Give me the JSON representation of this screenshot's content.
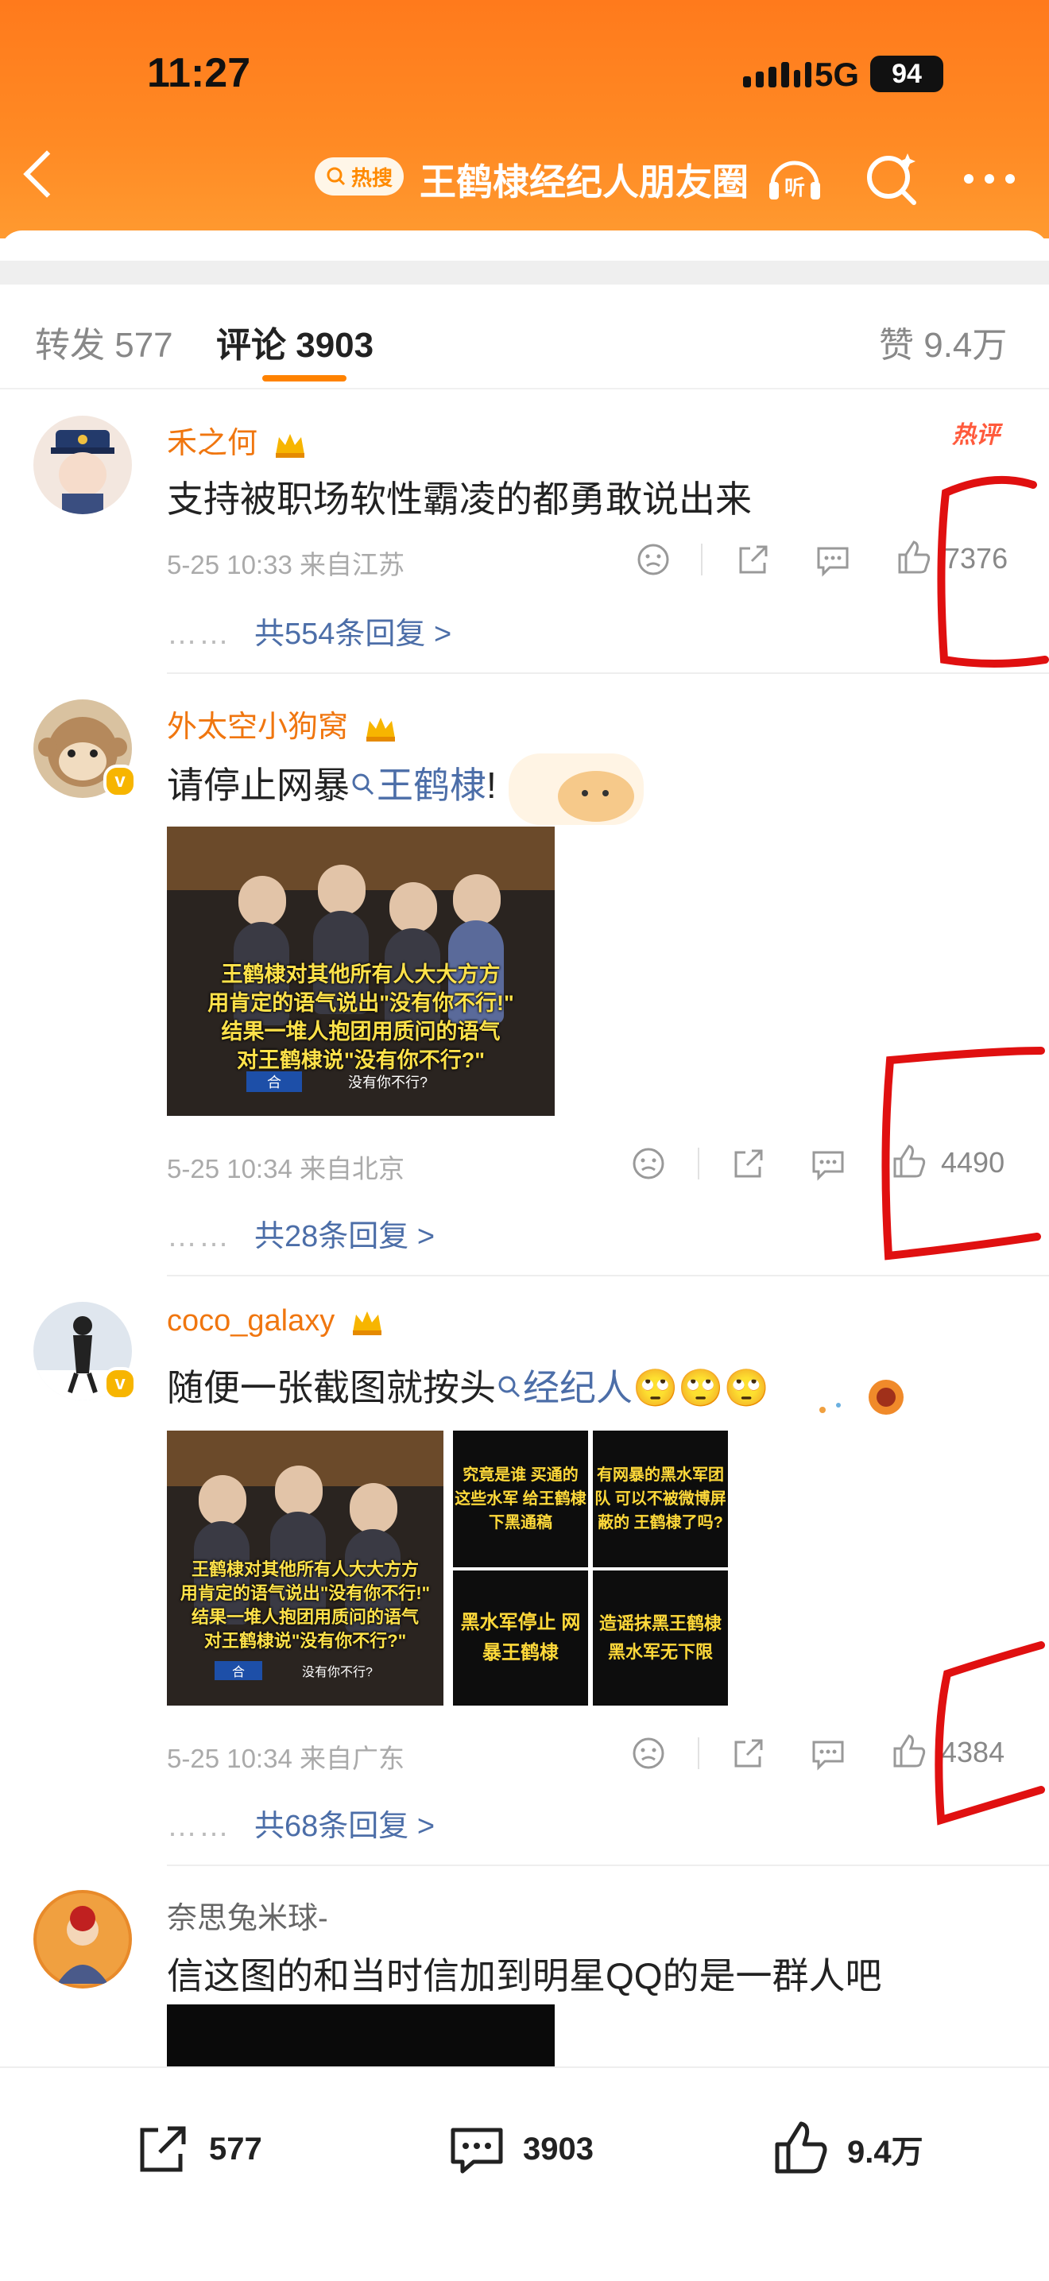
{
  "status": {
    "time": "11:27",
    "network": "5G",
    "battery": "94"
  },
  "header": {
    "hot_badge": "热搜",
    "title": "王鹤棣经纪人朋友圈"
  },
  "tabs": {
    "repost": "转发 577",
    "comments": "评论 3903",
    "likes": "赞 9.4万"
  },
  "hot_tag": "热评",
  "comments": [
    {
      "user": "禾之何",
      "text": "支持被职场软性霸凌的都勇敢说出来",
      "meta": "5-25 10:33 来自江苏",
      "likes": "7376",
      "replies": "共554条回复 >"
    },
    {
      "user": "外太空小狗窝",
      "text_before": "请停止网暴",
      "link": "王鹤棣",
      "text_after": "!",
      "meta": "5-25 10:34 来自北京",
      "likes": "4490",
      "replies": "共28条回复 >",
      "image_caption": [
        "王鹤棣对其他所有人大大方方",
        "用肯定的语气说出\"没有你不行!\"",
        "结果一堆人抱团用质问的语气",
        "对王鹤棣说\"没有你不行?\""
      ],
      "image_sub": "没有你不行?",
      "image_corner": "合"
    },
    {
      "user": "coco_galaxy",
      "text_before": "随便一张截图就按头",
      "link": "经纪人",
      "emoji": "🙄🙄🙄",
      "meta": "5-25 10:34 来自广东",
      "likes": "4384",
      "replies": "共68条回复 >",
      "image_caption": [
        "王鹤棣对其他所有人大大方方",
        "用肯定的语气说出\"没有你不行!\"",
        "结果一堆人抱团用质问的语气",
        "对王鹤棣说\"没有你不行?\""
      ],
      "image_sub": "没有你不行?",
      "image_corner": "合",
      "tiles": [
        "究竟是谁 买通的 这些水军 给王鹤棣 下黑通稿",
        "有网暴的黑水军团队 可以不被微博屏蔽的 王鹤棣了吗?",
        "黑水军停止 网暴王鹤棣",
        "造谣抹黑王鹤棣 黑水军无下限"
      ]
    },
    {
      "user": "奈思兔米球-",
      "text": "信这图的和当时信加到明星QQ的是一群人吧"
    }
  ],
  "dots": "……",
  "bottom": {
    "repost": "577",
    "comment": "3903",
    "like": "9.4万"
  },
  "colors": {
    "brand": "#ff8200",
    "link": "#4c6ea8",
    "username": "#f0760f",
    "annotation": "#e01010"
  }
}
